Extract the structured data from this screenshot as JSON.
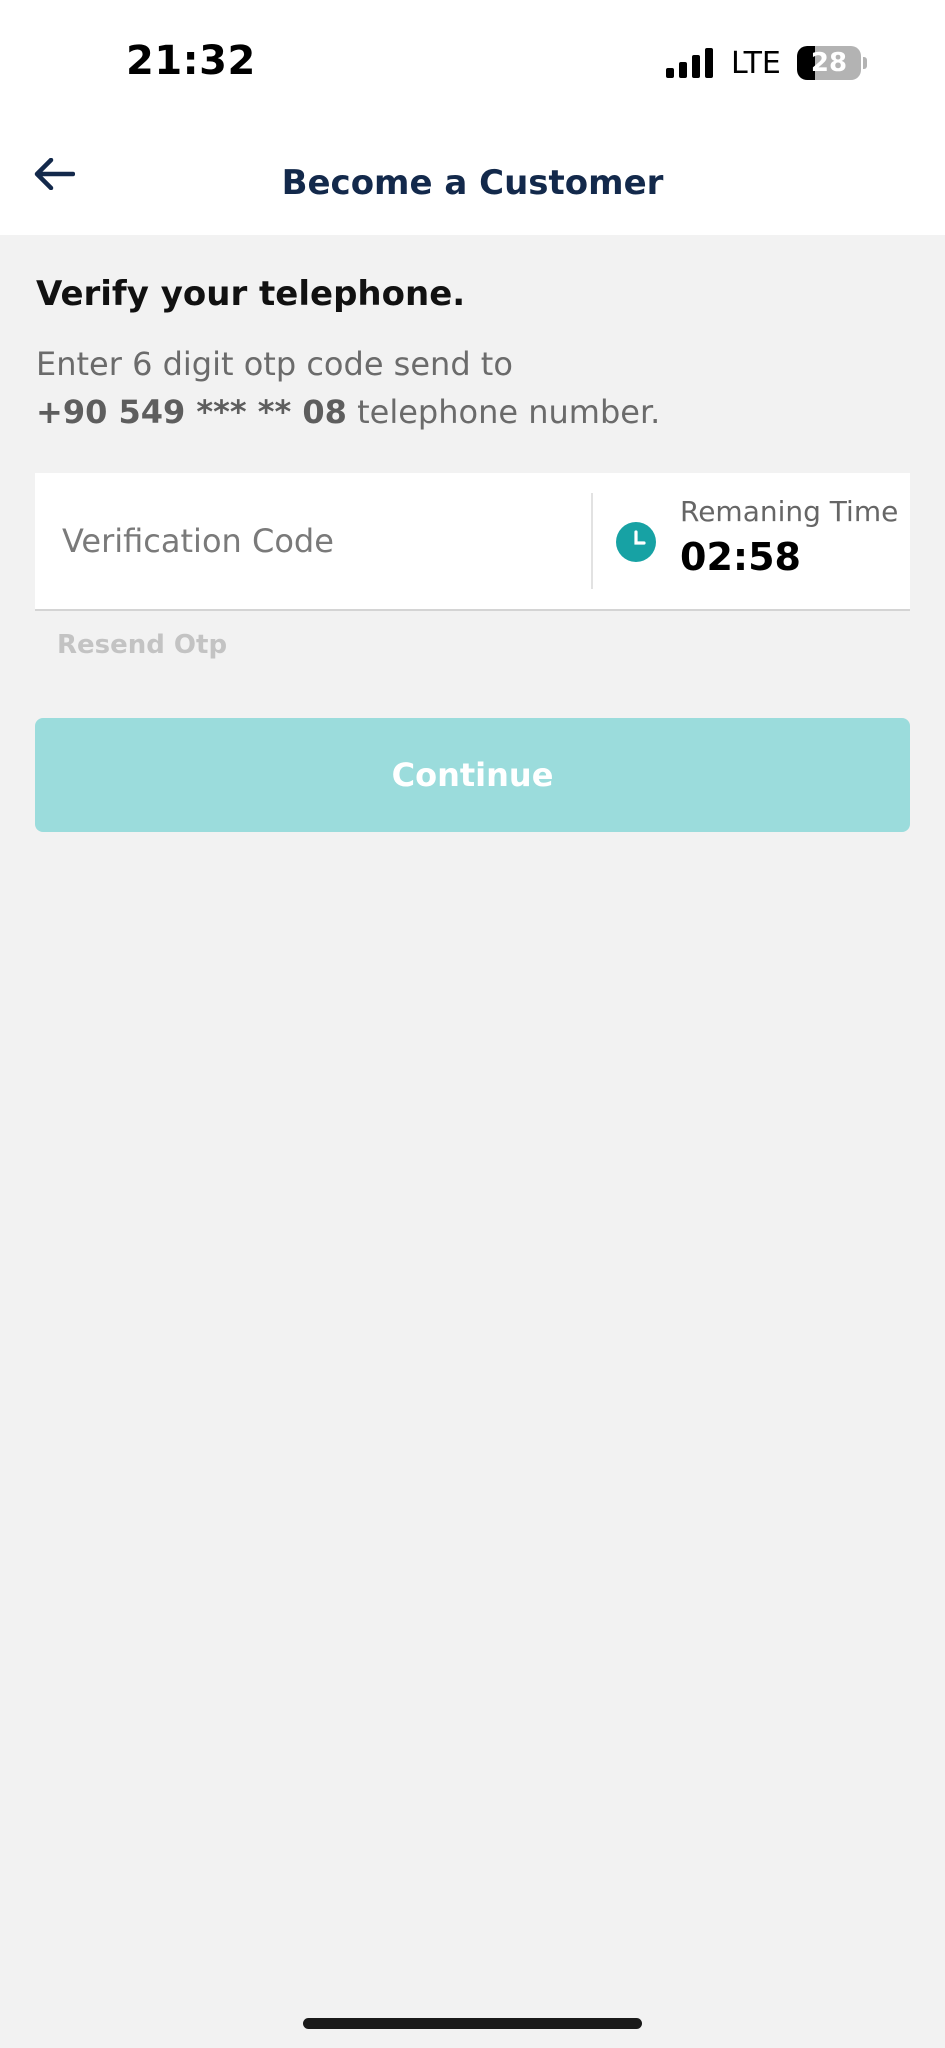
{
  "status_bar": {
    "time": "21:32",
    "network": "LTE",
    "battery": "28",
    "battery_level": 0.28,
    "icons": [
      "signal-bars-icon",
      "battery-icon"
    ]
  },
  "header": {
    "title": "Become a Customer",
    "back_icon": "arrow-left-icon"
  },
  "verify": {
    "title": "Verify your telephone.",
    "desc_line1": "Enter 6 digit otp code send to",
    "phone": "+90 549 *** ** 08",
    "desc_suffix": " telephone number."
  },
  "code_field": {
    "placeholder": "Verification Code",
    "value": "",
    "timer_icon": "clock-icon",
    "remaining_label": "Remaning Time",
    "remaining_value": "02:58"
  },
  "resend_label": "Resend Otp",
  "continue_label": "Continue",
  "colors": {
    "accent": "#17a2a4",
    "button_disabled": "#9bdcdc",
    "header_title": "#13294b",
    "background": "#f2f2f2"
  }
}
